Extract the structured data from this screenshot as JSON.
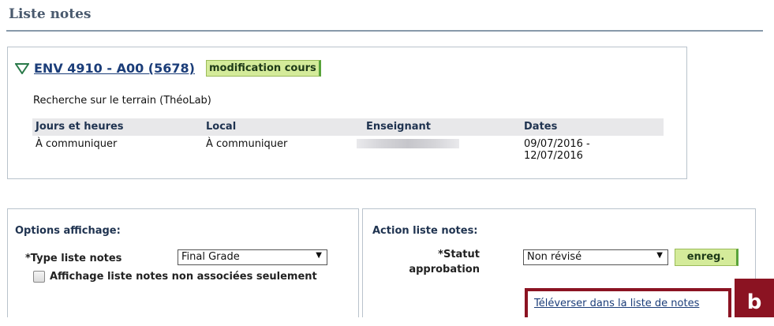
{
  "page": {
    "title": "Liste notes"
  },
  "course": {
    "code": "ENV 4910 - A00 (5678)",
    "modify_button": "modification cours",
    "description": "Recherche sur le terrain (ThéoLab)",
    "schedule": {
      "headers": [
        "Jours et heures",
        "Local",
        "Enseignant",
        "Dates"
      ],
      "row": {
        "days": "À communiquer",
        "room": "À communiquer",
        "teacher": "",
        "dates_line1": "09/07/2016 -",
        "dates_line2": "12/07/2016"
      }
    }
  },
  "display_options": {
    "title": "Options affichage:",
    "type_label": "*Type liste notes",
    "type_value": "Final Grade",
    "checkbox_label": "Affichage liste notes non associées seulement",
    "checkbox_checked": false
  },
  "actions": {
    "title": "Action liste notes:",
    "status_label_line1": "*Statut",
    "status_label_line2": "approbation",
    "status_value": "Non révisé",
    "save_button": "enreg.",
    "upload_link": "Téléverser dans la liste de notes"
  },
  "annotation": {
    "badge": "b",
    "color": "#8b1322"
  },
  "colors": {
    "accent_green": "#d4eb9a",
    "link": "#1b3d79",
    "title": "#4a5a6e"
  }
}
